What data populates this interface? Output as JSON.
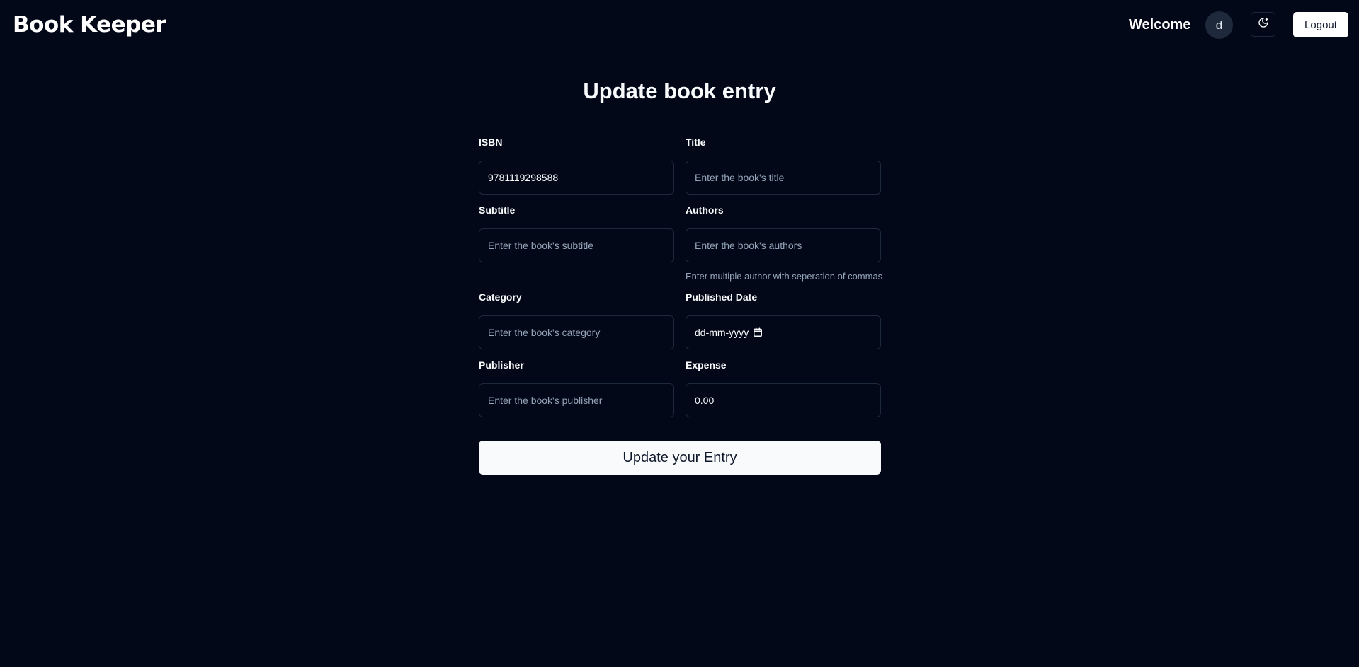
{
  "header": {
    "brand": "Book Keeper",
    "welcome": "Welcome",
    "avatar_initial": "d",
    "theme_icon": "moon-stars-icon",
    "logout_label": "Logout"
  },
  "page": {
    "title": "Update book entry"
  },
  "form": {
    "isbn": {
      "label": "ISBN",
      "value": "9781119298588",
      "placeholder": ""
    },
    "title": {
      "label": "Title",
      "value": "",
      "placeholder": "Enter the book's title"
    },
    "subtitle": {
      "label": "Subtitle",
      "value": "",
      "placeholder": "Enter the book's subtitle"
    },
    "authors": {
      "label": "Authors",
      "value": "",
      "placeholder": "Enter the book's authors",
      "hint": "Enter multiple author with seperation of commas"
    },
    "category": {
      "label": "Category",
      "value": "",
      "placeholder": "Enter the book's category"
    },
    "published_date": {
      "label": "Published Date",
      "display": "dd-mm-yyyy",
      "icon": "calendar-icon"
    },
    "publisher": {
      "label": "Publisher",
      "value": "",
      "placeholder": "Enter the book's publisher"
    },
    "expense": {
      "label": "Expense",
      "value": "0.00",
      "placeholder": ""
    },
    "submit_label": "Update your Entry"
  },
  "colors": {
    "background": "#020817",
    "border": "#1e293b",
    "muted_text": "#94a3b8",
    "button_bg": "#f8fafc"
  }
}
